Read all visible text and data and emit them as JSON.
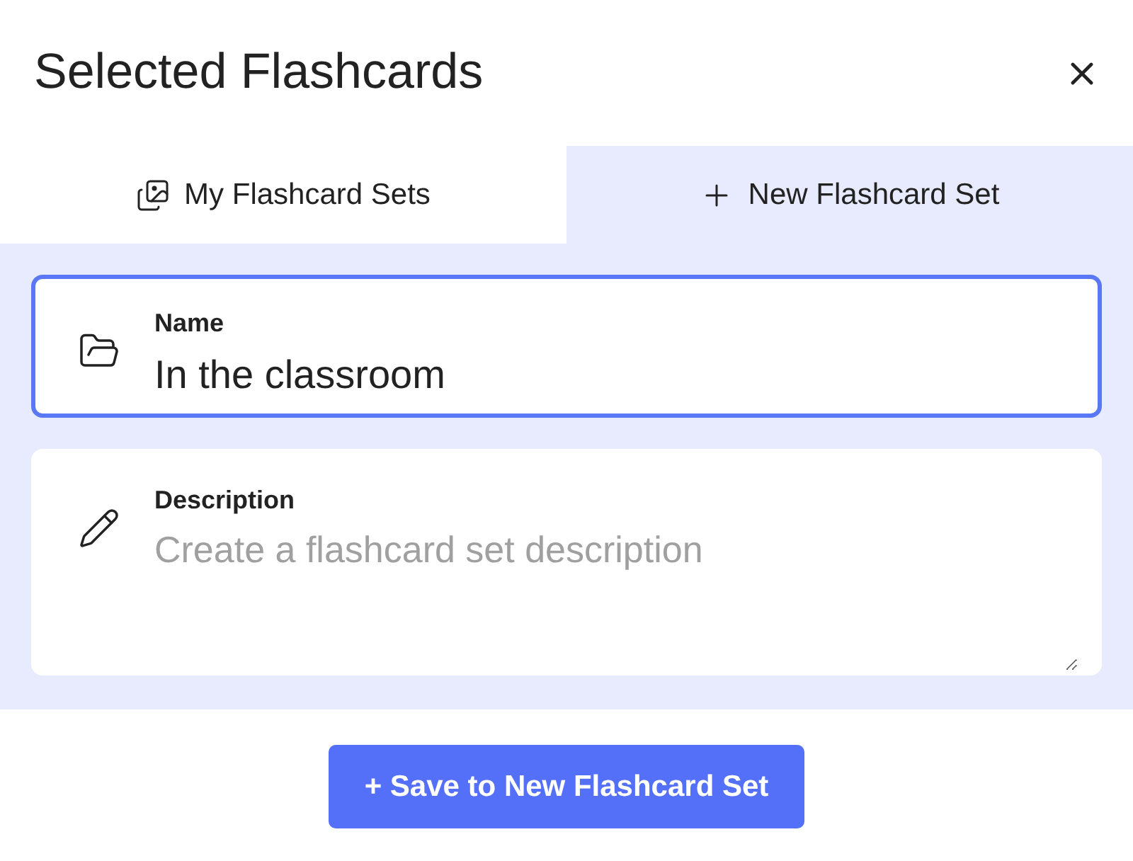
{
  "dialog": {
    "title": "Selected Flashcards"
  },
  "tabs": [
    {
      "label": "My Flashcard Sets",
      "kind": "gallery",
      "selected": false
    },
    {
      "label": "New Flashcard Set",
      "kind": "plus",
      "selected": true
    }
  ],
  "fields": [
    {
      "kind": "input",
      "label": "Name",
      "value": "In the classroom",
      "focused": true
    },
    {
      "kind": "textarea",
      "label": "Description",
      "placeholder": "Create a flashcard set description",
      "focused": false
    }
  ],
  "save_button": {
    "label": "+ Save to New Flashcard Set"
  }
}
